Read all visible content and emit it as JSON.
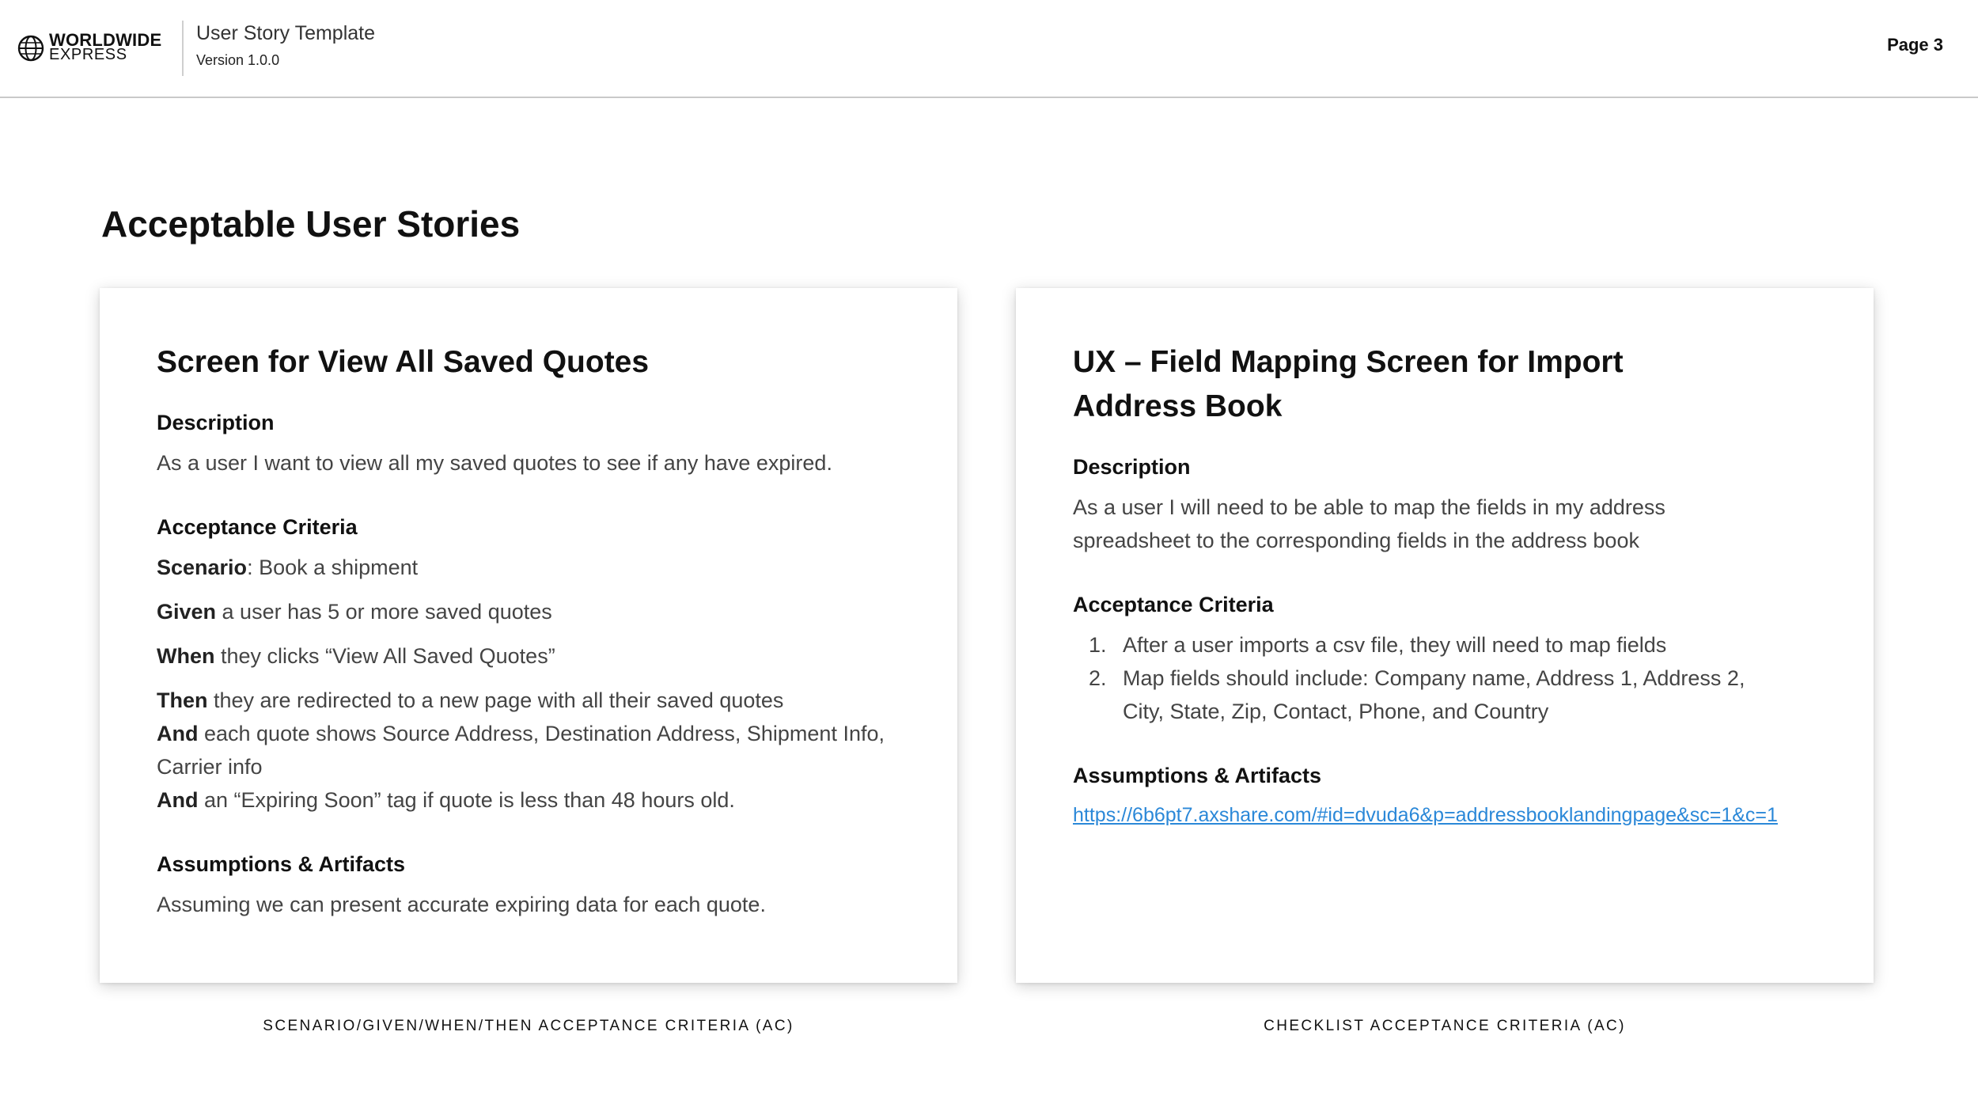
{
  "header": {
    "logo_line1": "WORLDWIDE",
    "logo_line2": "EXPRESS",
    "title": "User Story Template",
    "version": "Version 1.0.0",
    "page": "Page 3"
  },
  "section_title": "Acceptable User Stories",
  "left_card": {
    "title": "Screen for View All Saved Quotes",
    "description_heading": "Description",
    "description": "As a user I want to view all my saved quotes to see if any have expired.",
    "criteria_heading": "Acceptance Criteria",
    "scenario_kw": "Scenario",
    "scenario": ": Book a shipment",
    "given_kw": "Given",
    "given": " a user has 5 or more saved quotes",
    "when_kw": "When",
    "when": " they clicks “View All Saved Quotes”",
    "then_kw": "Then",
    "then": " they are redirected to a new page with all their saved quotes",
    "and1_kw": "And",
    "and1": " each quote shows Source Address, Destination Address, Shipment Info, Carrier info",
    "and2_kw": "And",
    "and2": " an “Expiring Soon” tag if quote is less than 48 hours old.",
    "assumptions_heading": "Assumptions & Artifacts",
    "assumptions": "Assuming we can present accurate expiring data for each quote."
  },
  "right_card": {
    "title_line1": "UX – Field Mapping Screen for Import",
    "title_line2": "Address Book",
    "description_heading": "Description",
    "description": "As a user I will need to be able to map the fields in my address spreadsheet to the corresponding fields in the address book",
    "criteria_heading": "Acceptance Criteria",
    "criteria": [
      {
        "num": "1.",
        "text": "After a user imports a csv file, they will need to map fields"
      },
      {
        "num": "2.",
        "text": "Map fields should include: Company name, Address 1, Address 2, City, State, Zip, Contact, Phone, and Country"
      }
    ],
    "assumptions_heading": "Assumptions & Artifacts",
    "link": "https://6b6pt7.axshare.com/#id=dvuda6&p=addressbooklandingpage&sc=1&c=1"
  },
  "captions": {
    "left": "SCENARIO/GIVEN/WHEN/THEN ACCEPTANCE CRITERIA (AC)",
    "right": "CHECKLIST ACCEPTANCE CRITERIA (AC)"
  },
  "colors": {
    "link": "#2b88d8",
    "body_text": "#444444",
    "header_rule": "#c9c9c9"
  },
  "icons": [
    "globe-logo-icon"
  ]
}
